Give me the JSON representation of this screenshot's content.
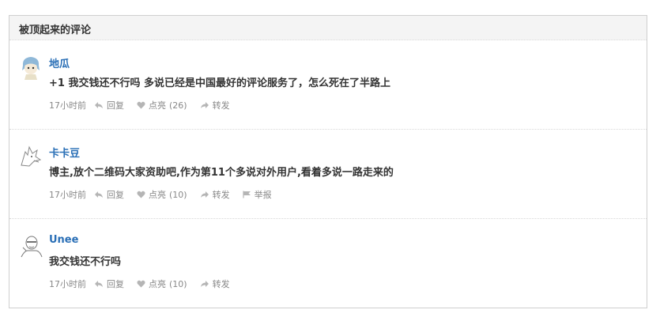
{
  "panel": {
    "title": "被顶起来的评论"
  },
  "comments": [
    {
      "author": "地瓜",
      "text": "+1 我交钱还不行吗 多说已经是中国最好的评论服务了，怎么死在了半路上",
      "time": "17小时前",
      "reply": "回复",
      "like": "点亮",
      "like_count": "(26)",
      "share": "转发"
    },
    {
      "author": "卡卡豆",
      "text": "博主,放个二维码大家资助吧,作为第11个多说对外用户,看着多说一路走来的",
      "time": "17小时前",
      "reply": "回复",
      "like": "点亮",
      "like_count": "(10)",
      "share": "转发",
      "report": "举报"
    },
    {
      "author": "Unee",
      "text": "我交钱还不行吗",
      "time": "17小时前",
      "reply": "回复",
      "like": "点亮",
      "like_count": "(10)",
      "share": "转发"
    }
  ],
  "icons": {
    "reply": "reply-icon",
    "like": "heart-icon",
    "share": "share-arrow-icon",
    "report": "flag-icon"
  },
  "colors": {
    "author": "#2a6fb6",
    "text": "#333333",
    "meta": "#888888",
    "header_bg": "#f4f4f4",
    "border": "#cfcfcf"
  }
}
